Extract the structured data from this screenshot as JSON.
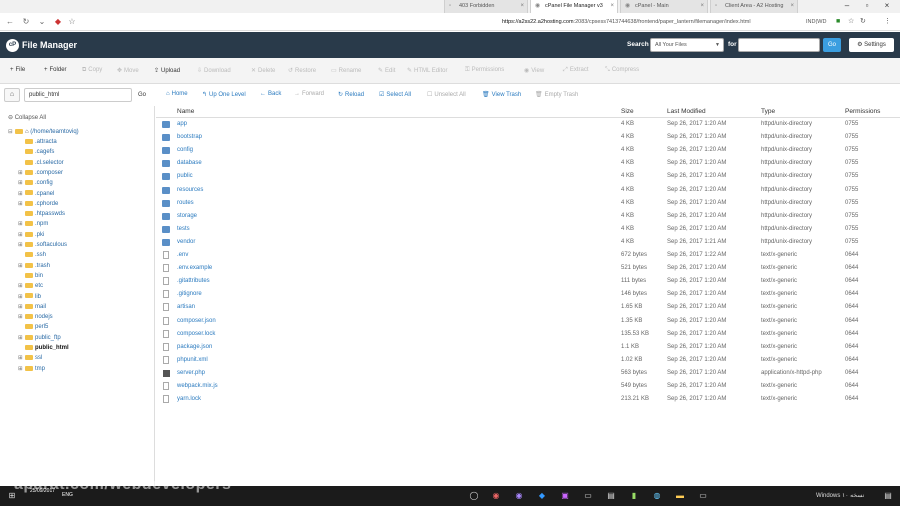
{
  "browser": {
    "tabs": [
      {
        "label": "403 Forbidden",
        "active": false
      },
      {
        "label": "cPanel File Manager v3",
        "active": true
      },
      {
        "label": "cPanel - Main",
        "active": false
      },
      {
        "label": "Client Area - A2 Hosting",
        "active": false
      }
    ],
    "url_host": "https://a2ss22.a2hosting.com",
    "url_path": ":2083/cpsess7413744638/frontend/paper_lantern/filemanager/index.html",
    "ext_label": "IND(WD"
  },
  "header": {
    "logo_text": "File Manager",
    "search_label": "Search",
    "search_scope": "All Your Files",
    "for_label": "for",
    "search_value": "",
    "go_label": "Go",
    "settings_label": "Settings"
  },
  "toolbar": {
    "file": "File",
    "folder": "Folder",
    "copy": "Copy",
    "move": "Move",
    "upload": "Upload",
    "download": "Download",
    "delete": "Delete",
    "restore": "Restore",
    "rename": "Rename",
    "edit": "Edit",
    "html_editor": "HTML Editor",
    "permissions": "Permissions",
    "view": "View",
    "extract": "Extract",
    "compress": "Compress"
  },
  "subbar": {
    "path_value": "public_html",
    "go_label": "Go",
    "home": "Home",
    "up_one_level": "Up One Level",
    "back": "Back",
    "forward": "Forward",
    "reload": "Reload",
    "select_all": "Select All",
    "unselect_all": "Unselect All",
    "view_trash": "View Trash",
    "empty_trash": "Empty Trash"
  },
  "sidebar": {
    "collapse_all": "Collapse All",
    "root": "(/home/teamtoviq)",
    "items": [
      {
        "label": ".attracta",
        "toggle": ""
      },
      {
        "label": ".cagefs",
        "toggle": ""
      },
      {
        "label": ".cl.selector",
        "toggle": ""
      },
      {
        "label": ".composer",
        "toggle": "⊞"
      },
      {
        "label": ".config",
        "toggle": "⊞"
      },
      {
        "label": ".cpanel",
        "toggle": "⊞"
      },
      {
        "label": ".cphorde",
        "toggle": "⊞"
      },
      {
        "label": ".htpasswds",
        "toggle": ""
      },
      {
        "label": ".npm",
        "toggle": "⊞"
      },
      {
        "label": ".pki",
        "toggle": "⊞"
      },
      {
        "label": ".softaculous",
        "toggle": "⊞"
      },
      {
        "label": ".ssh",
        "toggle": ""
      },
      {
        "label": ".trash",
        "toggle": "⊞"
      },
      {
        "label": "bin",
        "toggle": ""
      },
      {
        "label": "etc",
        "toggle": "⊞"
      },
      {
        "label": "lib",
        "toggle": "⊞"
      },
      {
        "label": "mail",
        "toggle": "⊞"
      },
      {
        "label": "nodejs",
        "toggle": "⊞"
      },
      {
        "label": "perl5",
        "toggle": ""
      },
      {
        "label": "public_ftp",
        "toggle": "⊞"
      },
      {
        "label": "public_html",
        "toggle": "",
        "selected": true
      },
      {
        "label": "ssl",
        "toggle": "⊞"
      },
      {
        "label": "tmp",
        "toggle": "⊞"
      }
    ]
  },
  "table": {
    "columns": {
      "name": "Name",
      "size": "Size",
      "modified": "Last Modified",
      "type": "Type",
      "perms": "Permissions"
    },
    "rows": [
      {
        "icon": "folder",
        "name": "app",
        "size": "4 KB",
        "modified": "Sep 26, 2017 1:20 AM",
        "type": "httpd/unix-directory",
        "perms": "0755"
      },
      {
        "icon": "folder",
        "name": "bootstrap",
        "size": "4 KB",
        "modified": "Sep 26, 2017 1:20 AM",
        "type": "httpd/unix-directory",
        "perms": "0755"
      },
      {
        "icon": "folder",
        "name": "config",
        "size": "4 KB",
        "modified": "Sep 26, 2017 1:20 AM",
        "type": "httpd/unix-directory",
        "perms": "0755"
      },
      {
        "icon": "folder",
        "name": "database",
        "size": "4 KB",
        "modified": "Sep 26, 2017 1:20 AM",
        "type": "httpd/unix-directory",
        "perms": "0755"
      },
      {
        "icon": "folder",
        "name": "public",
        "size": "4 KB",
        "modified": "Sep 26, 2017 1:20 AM",
        "type": "httpd/unix-directory",
        "perms": "0755"
      },
      {
        "icon": "folder",
        "name": "resources",
        "size": "4 KB",
        "modified": "Sep 26, 2017 1:20 AM",
        "type": "httpd/unix-directory",
        "perms": "0755"
      },
      {
        "icon": "folder",
        "name": "routes",
        "size": "4 KB",
        "modified": "Sep 26, 2017 1:20 AM",
        "type": "httpd/unix-directory",
        "perms": "0755"
      },
      {
        "icon": "folder",
        "name": "storage",
        "size": "4 KB",
        "modified": "Sep 26, 2017 1:20 AM",
        "type": "httpd/unix-directory",
        "perms": "0755"
      },
      {
        "icon": "folder",
        "name": "tests",
        "size": "4 KB",
        "modified": "Sep 26, 2017 1:20 AM",
        "type": "httpd/unix-directory",
        "perms": "0755"
      },
      {
        "icon": "folder",
        "name": "vendor",
        "size": "4 KB",
        "modified": "Sep 26, 2017 1:21 AM",
        "type": "httpd/unix-directory",
        "perms": "0755"
      },
      {
        "icon": "file",
        "name": ".env",
        "size": "672 bytes",
        "modified": "Sep 26, 2017 1:22 AM",
        "type": "text/x-generic",
        "perms": "0644"
      },
      {
        "icon": "file",
        "name": ".env.example",
        "size": "521 bytes",
        "modified": "Sep 26, 2017 1:20 AM",
        "type": "text/x-generic",
        "perms": "0644"
      },
      {
        "icon": "file",
        "name": ".gitattributes",
        "size": "111 bytes",
        "modified": "Sep 26, 2017 1:20 AM",
        "type": "text/x-generic",
        "perms": "0644"
      },
      {
        "icon": "file",
        "name": ".gitignore",
        "size": "146 bytes",
        "modified": "Sep 26, 2017 1:20 AM",
        "type": "text/x-generic",
        "perms": "0644"
      },
      {
        "icon": "file",
        "name": "artisan",
        "size": "1.65 KB",
        "modified": "Sep 26, 2017 1:20 AM",
        "type": "text/x-generic",
        "perms": "0644"
      },
      {
        "icon": "file",
        "name": "composer.json",
        "size": "1.35 KB",
        "modified": "Sep 26, 2017 1:20 AM",
        "type": "text/x-generic",
        "perms": "0644"
      },
      {
        "icon": "file",
        "name": "composer.lock",
        "size": "135.53 KB",
        "modified": "Sep 26, 2017 1:20 AM",
        "type": "text/x-generic",
        "perms": "0644"
      },
      {
        "icon": "file",
        "name": "package.json",
        "size": "1.1 KB",
        "modified": "Sep 26, 2017 1:20 AM",
        "type": "text/x-generic",
        "perms": "0644"
      },
      {
        "icon": "file",
        "name": "phpunit.xml",
        "size": "1.02 KB",
        "modified": "Sep 26, 2017 1:20 AM",
        "type": "text/x-generic",
        "perms": "0644"
      },
      {
        "icon": "php",
        "name": "server.php",
        "size": "563 bytes",
        "modified": "Sep 26, 2017 1:20 AM",
        "type": "application/x-httpd-php",
        "perms": "0644"
      },
      {
        "icon": "file",
        "name": "webpack.mix.js",
        "size": "549 bytes",
        "modified": "Sep 26, 2017 1:20 AM",
        "type": "text/x-generic",
        "perms": "0644"
      },
      {
        "icon": "file",
        "name": "yarn.lock",
        "size": "213.21 KB",
        "modified": "Sep 26, 2017 1:20 AM",
        "type": "text/x-generic",
        "perms": "0644"
      }
    ]
  },
  "taskbar": {
    "time": "25/09/2017",
    "lang": "ENG",
    "windows_label": "Windows ۱۰ نسخه"
  },
  "watermark": "aparat.com/webdevelopers",
  "colors": {
    "header_bg": "#293a4a",
    "link": "#2a7abf",
    "go_button": "#3b9ee0",
    "folder_icon": "#5a8fc7"
  }
}
